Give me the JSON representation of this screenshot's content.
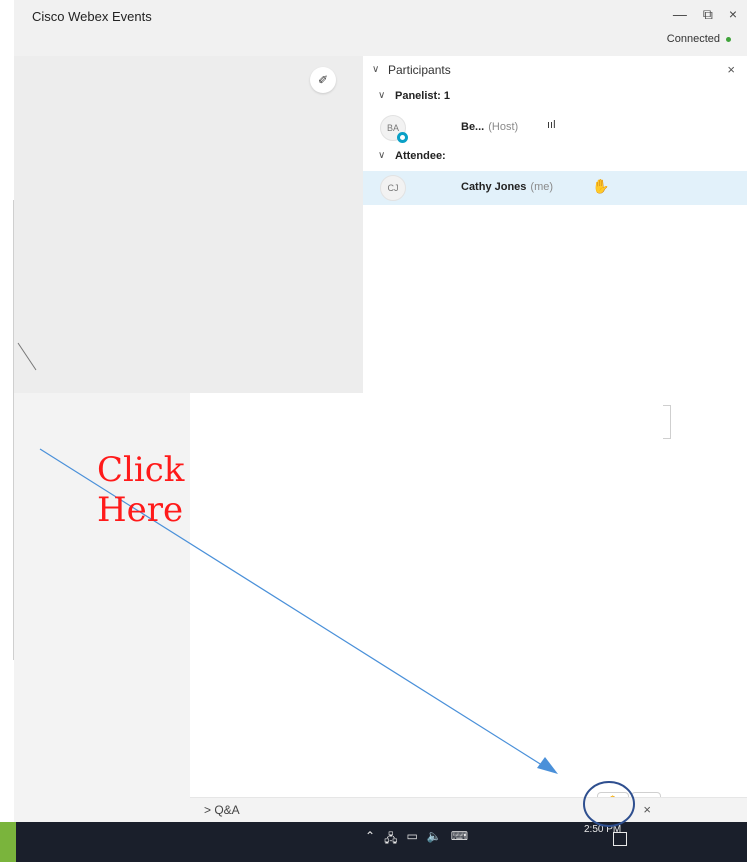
{
  "window": {
    "title": "Cisco Webex Events",
    "controls": {
      "minimize": "—",
      "restore": "⧉",
      "close": "×"
    },
    "status": "Connected",
    "status_color": "#3fa33a"
  },
  "stage": {
    "annotate_icon": "pen-icon",
    "annotate_glyph": "✐"
  },
  "participants": {
    "title": "Participants",
    "close": "×",
    "groups": [
      {
        "title": "Panelist: 1",
        "members": [
          {
            "initials": "BA",
            "name": "Be...",
            "role": "(Host)",
            "indicator": "signal-icon",
            "indicator_glyph": "ııl"
          }
        ]
      },
      {
        "title": "Attendee:",
        "members": [
          {
            "initials": "CJ",
            "name": "Cathy Jones",
            "role": "(me)",
            "indicator": "raised-hand-icon",
            "indicator_glyph": "✋"
          }
        ]
      }
    ]
  },
  "controls_bar": {
    "raise_hand_glyph": "✋",
    "audio_glyph": "🔈⌄"
  },
  "qa": {
    "label": "> Q&A",
    "close": "×"
  },
  "taskbar": {
    "tray_glyphs": [
      "⌃",
      "🖧",
      "▭",
      "🔈",
      "⌨"
    ],
    "time": "2:50 PM"
  },
  "annotation": {
    "text": "Click\nHere",
    "color": "#ff1a1a",
    "arrow_color": "#4a90d9",
    "circle_color": "#2e4f8f"
  }
}
